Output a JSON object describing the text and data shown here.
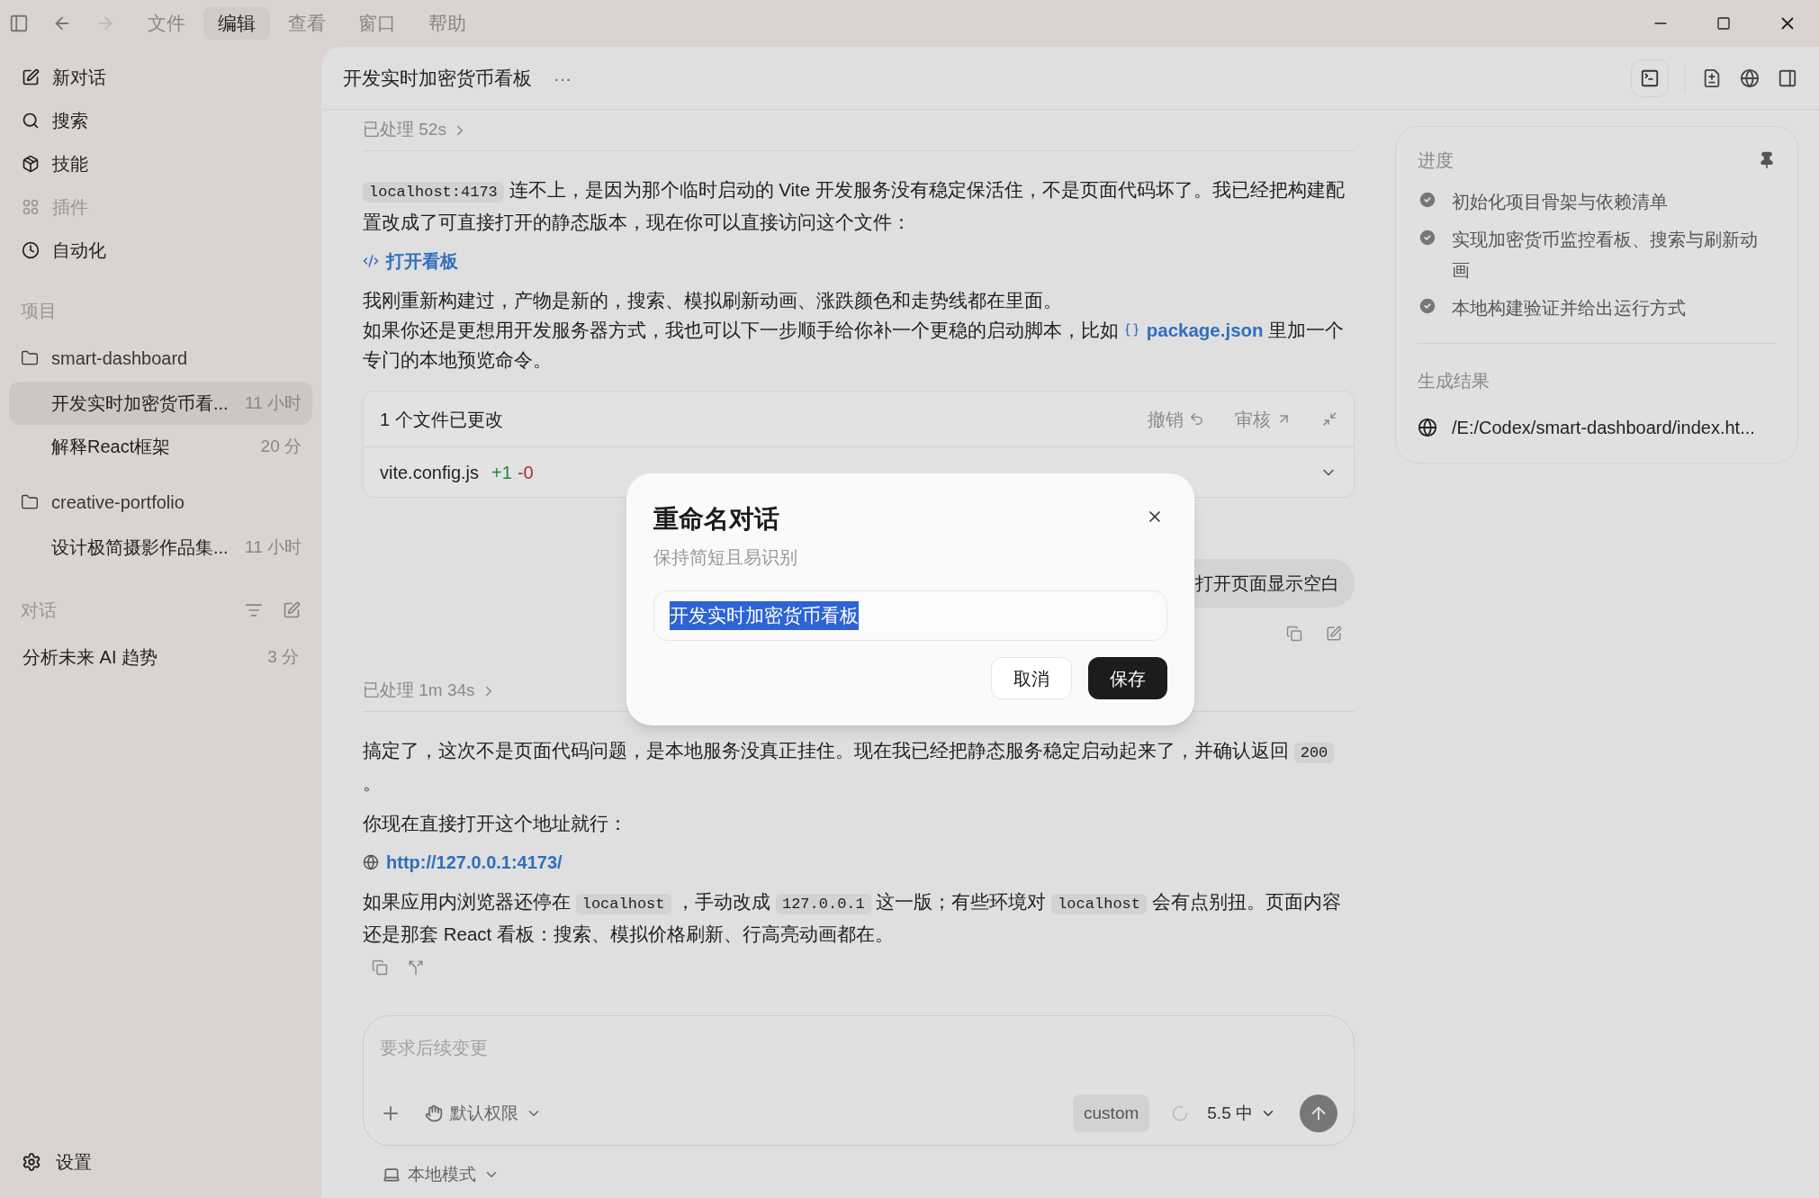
{
  "menu_bar": {
    "items": [
      {
        "label": "文件",
        "selected": false
      },
      {
        "label": "编辑",
        "selected": true
      },
      {
        "label": "查看",
        "selected": false
      },
      {
        "label": "窗口",
        "selected": false
      },
      {
        "label": "帮助",
        "selected": false
      }
    ]
  },
  "sidebar": {
    "nav": [
      {
        "kind": "new",
        "label": "新对话",
        "disabled": false
      },
      {
        "kind": "search",
        "label": "搜索",
        "disabled": false
      },
      {
        "kind": "skills",
        "label": "技能",
        "disabled": false
      },
      {
        "kind": "plugins",
        "label": "插件",
        "disabled": true
      },
      {
        "kind": "automation",
        "label": "自动化",
        "disabled": false
      }
    ],
    "projects_heading": "项目",
    "projects": [
      {
        "name": "smart-dashboard",
        "threads": [
          {
            "title": "开发实时加密货币看...",
            "time": "11 小时",
            "selected": true
          },
          {
            "title": "解释React框架",
            "time": "20 分",
            "selected": false
          }
        ]
      },
      {
        "name": "creative-portfolio",
        "threads": [
          {
            "title": "设计极简摄影作品集...",
            "time": "11 小时",
            "selected": false
          }
        ]
      }
    ],
    "conversations_heading": "对话",
    "conversations": [
      {
        "title": "分析未来 AI 趋势",
        "time": "3 分",
        "selected": false
      }
    ],
    "settings": "设置"
  },
  "chat": {
    "title": "开发实时加密货币看板",
    "more": "···",
    "blocks": [
      {
        "kind": "processed",
        "text": "已处理 52s"
      },
      {
        "kind": "paragraph",
        "parts": [
          {
            "kind": "code",
            "text": "localhost:4173"
          },
          {
            "kind": "text",
            "text": " 连不上，是因为那个临时启动的 Vite 开发服务没有稳定保活住，不是页面代码坏了。我已经把构建配置改成了可直接打开的静态版本，现在你可以直接访问这个文件："
          }
        ]
      },
      {
        "kind": "file_link",
        "text": "打开看板"
      },
      {
        "kind": "paragraph",
        "parts": [
          {
            "kind": "text",
            "text": "我刚重新构建过，产物是新的，搜索、模拟刷新动画、涨跌颜色和走势线都在里面。"
          },
          {
            "kind": "break"
          },
          {
            "kind": "text",
            "text": "如果你还是更想用开发服务器方式，我也可以下一步顺手给你补一个更稳的启动脚本，比如 "
          },
          {
            "kind": "file",
            "text": "package.json"
          },
          {
            "kind": "text",
            "text": " 里加一个专门的本地预览命令。"
          }
        ]
      },
      {
        "kind": "changes",
        "title": "1 个文件已更改",
        "undo": "撤销",
        "review": "审核",
        "files": [
          {
            "name": "vite.config.js",
            "added": "+1",
            "removed": "-0"
          }
        ]
      },
      {
        "kind": "user",
        "text": "打开页面显示空白"
      },
      {
        "kind": "processed",
        "text": "已处理 1m 34s"
      },
      {
        "kind": "paragraph",
        "parts": [
          {
            "kind": "text",
            "text": "搞定了，这次不是页面代码问题，是本地服务没真正挂住。现在我已经把静态服务稳定启动起来了，并确认返回 "
          },
          {
            "kind": "code",
            "text": "200"
          },
          {
            "kind": "text",
            "text": " 。"
          }
        ]
      },
      {
        "kind": "paragraph",
        "parts": [
          {
            "kind": "text",
            "text": "你现在直接打开这个地址就行："
          }
        ]
      },
      {
        "kind": "url_link",
        "text": "http://127.0.0.1:4173/"
      },
      {
        "kind": "paragraph",
        "parts": [
          {
            "kind": "text",
            "text": "如果应用内浏览器还停在 "
          },
          {
            "kind": "code",
            "text": "localhost"
          },
          {
            "kind": "text",
            "text": " ，手动改成 "
          },
          {
            "kind": "code",
            "text": "127.0.0.1"
          },
          {
            "kind": "text",
            "text": " 这一版；有些环境对 "
          },
          {
            "kind": "code",
            "text": "localhost"
          },
          {
            "kind": "text",
            "text": " 会有点别扭。页面内容还是那套 React 看板：搜索、模拟价格刷新、行高亮动画都在。"
          }
        ]
      },
      {
        "kind": "reply_actions"
      }
    ],
    "composer": {
      "placeholder": "要求后续变更",
      "permission": "默认权限",
      "model_tag": "custom",
      "model": "5.5 中"
    },
    "mode": "本地模式"
  },
  "progress_panel": {
    "title": "进度",
    "steps": [
      {
        "text": "初始化项目骨架与依赖清单",
        "done": true
      },
      {
        "text": "实现加密货币监控看板、搜索与刷新动画",
        "done": true
      },
      {
        "text": "本地构建验证并给出运行方式",
        "done": true
      }
    ],
    "result_title": "生成结果",
    "result_path": "/E:/Codex/smart-dashboard/index.ht..."
  },
  "dialog": {
    "title": "重命名对话",
    "subtitle": "保持简短且易识别",
    "value": "开发实时加密货币看板",
    "value_selected": true,
    "cancel": "取消",
    "save": "保存"
  }
}
